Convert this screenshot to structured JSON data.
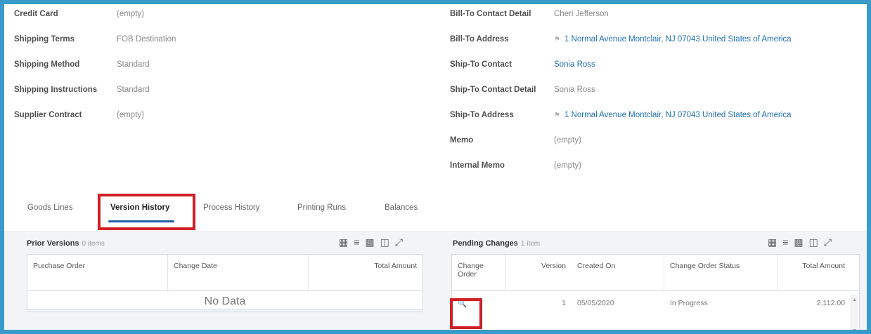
{
  "left_fields": [
    {
      "label": "Credit Card",
      "value": "(empty)"
    },
    {
      "label": "Shipping Terms",
      "value": "FOB Destination"
    },
    {
      "label": "Shipping Method",
      "value": "Standard"
    },
    {
      "label": "Shipping Instructions",
      "value": "Standard"
    },
    {
      "label": "Supplier Contract",
      "value": "(empty)"
    }
  ],
  "right_fields": [
    {
      "label": "Bill-To Contact Detail",
      "value": "Cheri Jefferson"
    },
    {
      "label": "Bill-To Address",
      "value": "1 Normal Avenue Montclair, NJ 07043 United States of America"
    },
    {
      "label": "Ship-To Contact",
      "value": "Sonia Ross"
    },
    {
      "label": "Ship-To Contact Detail",
      "value": "Sonia Ross"
    },
    {
      "label": "Ship-To Address",
      "value": "1 Normal Avenue Montclair, NJ 07043 United States of America"
    },
    {
      "label": "Memo",
      "value": "(empty)"
    },
    {
      "label": "Internal Memo",
      "value": "(empty)"
    }
  ],
  "tabs": [
    "Goods Lines",
    "Version History",
    "Process History",
    "Printing Runs",
    "Balances"
  ],
  "active_tab": "Version History",
  "prior_versions": {
    "title": "Prior Versions",
    "count": "0 items",
    "columns": [
      "Purchase Order",
      "Change Date",
      "Total Amount"
    ],
    "empty_text": "No Data"
  },
  "pending_changes": {
    "title": "Pending Changes",
    "count": "1 item",
    "columns": [
      "Change Order",
      "Version",
      "Created On",
      "Change Order Status",
      "Total Amount"
    ],
    "rows": [
      {
        "version": "1",
        "created_on": "05/05/2020",
        "status": "In Progress",
        "total": "2,112.00"
      }
    ]
  },
  "colors": {
    "accent": "#1f5fa9",
    "highlight": "#d11f26",
    "frame": "#3a9ac9"
  },
  "icons": {
    "toolbar": [
      "export-excel-icon",
      "filter-icon",
      "chart-icon",
      "column-icon",
      "fullscreen-icon"
    ],
    "row_action": "magnifier-icon"
  }
}
